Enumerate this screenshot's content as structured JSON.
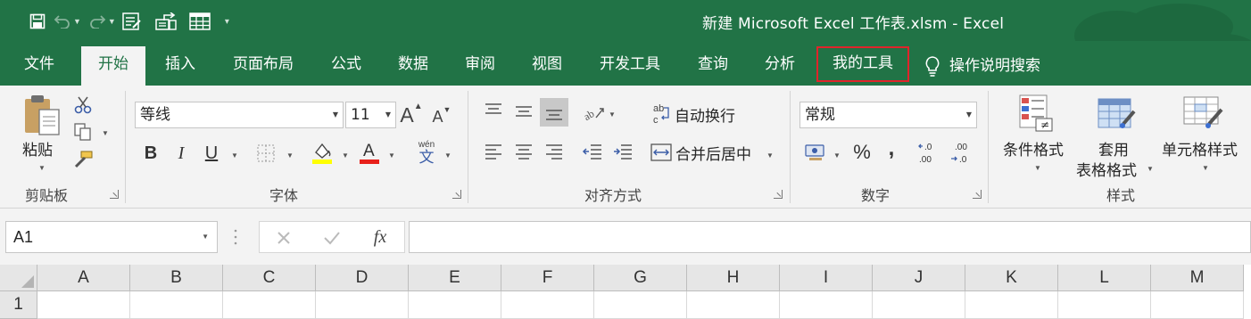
{
  "title_bar": {
    "document_title": "新建 Microsoft Excel 工作表.xlsm  -  Excel",
    "quick_access": [
      "save-icon",
      "undo-icon",
      "redo-icon",
      "form-icon",
      "export-icon",
      "table-icon",
      "customize-icon"
    ]
  },
  "tabs": [
    {
      "label": "文件",
      "active": false
    },
    {
      "label": "开始",
      "active": true
    },
    {
      "label": "插入",
      "active": false
    },
    {
      "label": "页面布局",
      "active": false
    },
    {
      "label": "公式",
      "active": false
    },
    {
      "label": "数据",
      "active": false
    },
    {
      "label": "审阅",
      "active": false
    },
    {
      "label": "视图",
      "active": false
    },
    {
      "label": "开发工具",
      "active": false
    },
    {
      "label": "查询",
      "active": false
    },
    {
      "label": "分析",
      "active": false
    },
    {
      "label": "我的工具",
      "active": false,
      "highlighted": true
    },
    {
      "label": "操作说明搜索",
      "active": false
    }
  ],
  "ribbon": {
    "clipboard": {
      "group_label": "剪贴板",
      "paste_label": "粘贴"
    },
    "font": {
      "group_label": "字体",
      "font_name": "等线",
      "font_size": "11",
      "bold": "B",
      "italic": "I",
      "underline": "U",
      "phonetic_top": "wén",
      "phonetic_bottom": "文",
      "font_color_swatch": "#e8201a",
      "fill_color_swatch": "#ffff00"
    },
    "alignment": {
      "group_label": "对齐方式",
      "wrap_text": "自动换行",
      "merge_center": "合并后居中"
    },
    "number": {
      "group_label": "数字",
      "format": "常规",
      "percent": "%",
      "comma": ","
    },
    "styles": {
      "group_label": "样式",
      "conditional": "条件格式",
      "table_line1": "套用",
      "table_line2": "表格格式",
      "cell_styles": "单元格样式"
    }
  },
  "formula_bar": {
    "name_box": "A1",
    "fx": "fx",
    "formula": ""
  },
  "grid": {
    "columns": [
      "A",
      "B",
      "C",
      "D",
      "E",
      "F",
      "G",
      "H",
      "I",
      "J",
      "K",
      "L",
      "M"
    ],
    "rows": [
      "1"
    ]
  },
  "colors": {
    "brand": "#217346",
    "highlight_box": "#e0242b"
  }
}
